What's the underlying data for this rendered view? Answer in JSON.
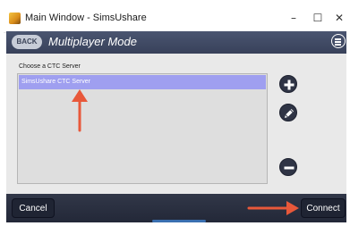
{
  "window": {
    "title": "Main Window - SimsUshare",
    "minimize_glyph": "–",
    "maximize_glyph": "☐",
    "close_glyph": "✕"
  },
  "header": {
    "back_label": "BACK",
    "title": "Multiplayer Mode"
  },
  "server_list": {
    "label": "Choose a CTC Server",
    "items": [
      "SimsUshare CTC Server"
    ],
    "selected_index": 0
  },
  "side_buttons": [
    "add-icon",
    "pencil-icon",
    "minus-icon"
  ],
  "footer": {
    "cancel_label": "Cancel",
    "connect_label": "Connect"
  },
  "colors": {
    "header_bg": "#38415a",
    "selected_row": "#9f9ff0",
    "annotation_arrow": "#e8583a",
    "button_dark": "#2f3445"
  }
}
